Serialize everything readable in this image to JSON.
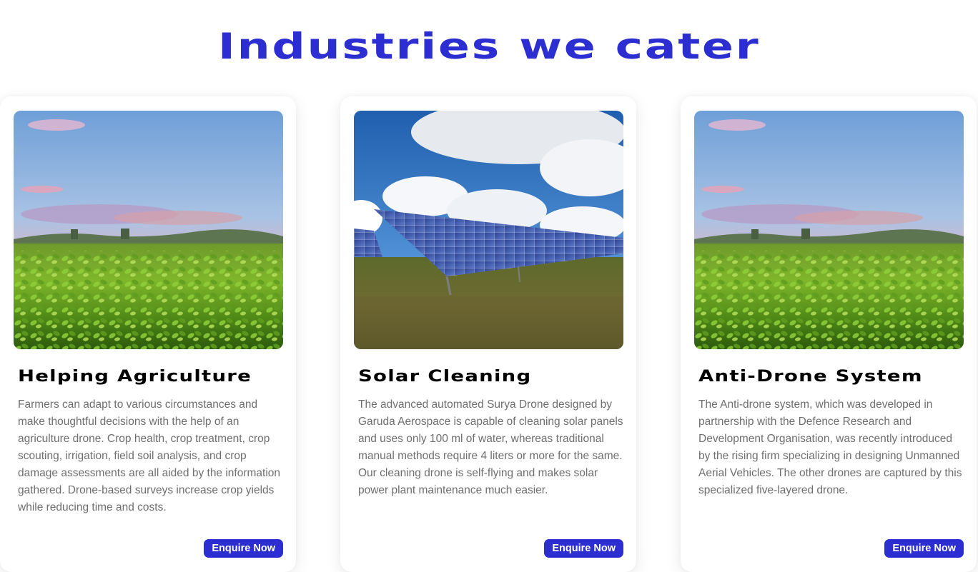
{
  "section": {
    "title": "Industries we cater"
  },
  "colors": {
    "accent": "#2d2ed1",
    "heading": "#000000",
    "body_text": "#6e6e6e",
    "button_text": "#ffffff"
  },
  "cards": [
    {
      "image": "agriculture-field-photo",
      "title": "Helping Agriculture",
      "description": "Farmers can adapt to various circumstances and make thoughtful decisions with the help of an agriculture drone. Crop health, crop treatment, crop scouting, irrigation, field soil analysis, and crop damage assessments are all aided by the information gathered. Drone-based surveys increase crop yields while reducing time and costs.",
      "button_label": "Enquire Now"
    },
    {
      "image": "solar-panels-photo",
      "title": "Solar Cleaning",
      "description": "The advanced automated Surya Drone designed by Garuda Aerospace is capable of cleaning solar panels and uses only 100 ml of water, whereas traditional manual methods require 4 liters or more for the same. Our cleaning drone is self-flying and makes solar power plant maintenance much easier.",
      "button_label": "Enquire Now"
    },
    {
      "image": "agriculture-field-photo",
      "title": "Anti-Drone System",
      "description": "The Anti-drone system, which was developed in partnership with the Defence Research and Development Organisation, was recently introduced by the rising firm specializing in designing Unmanned Aerial Vehicles. The other drones are captured by this specialized five-layered drone.",
      "button_label": "Enquire Now"
    }
  ]
}
